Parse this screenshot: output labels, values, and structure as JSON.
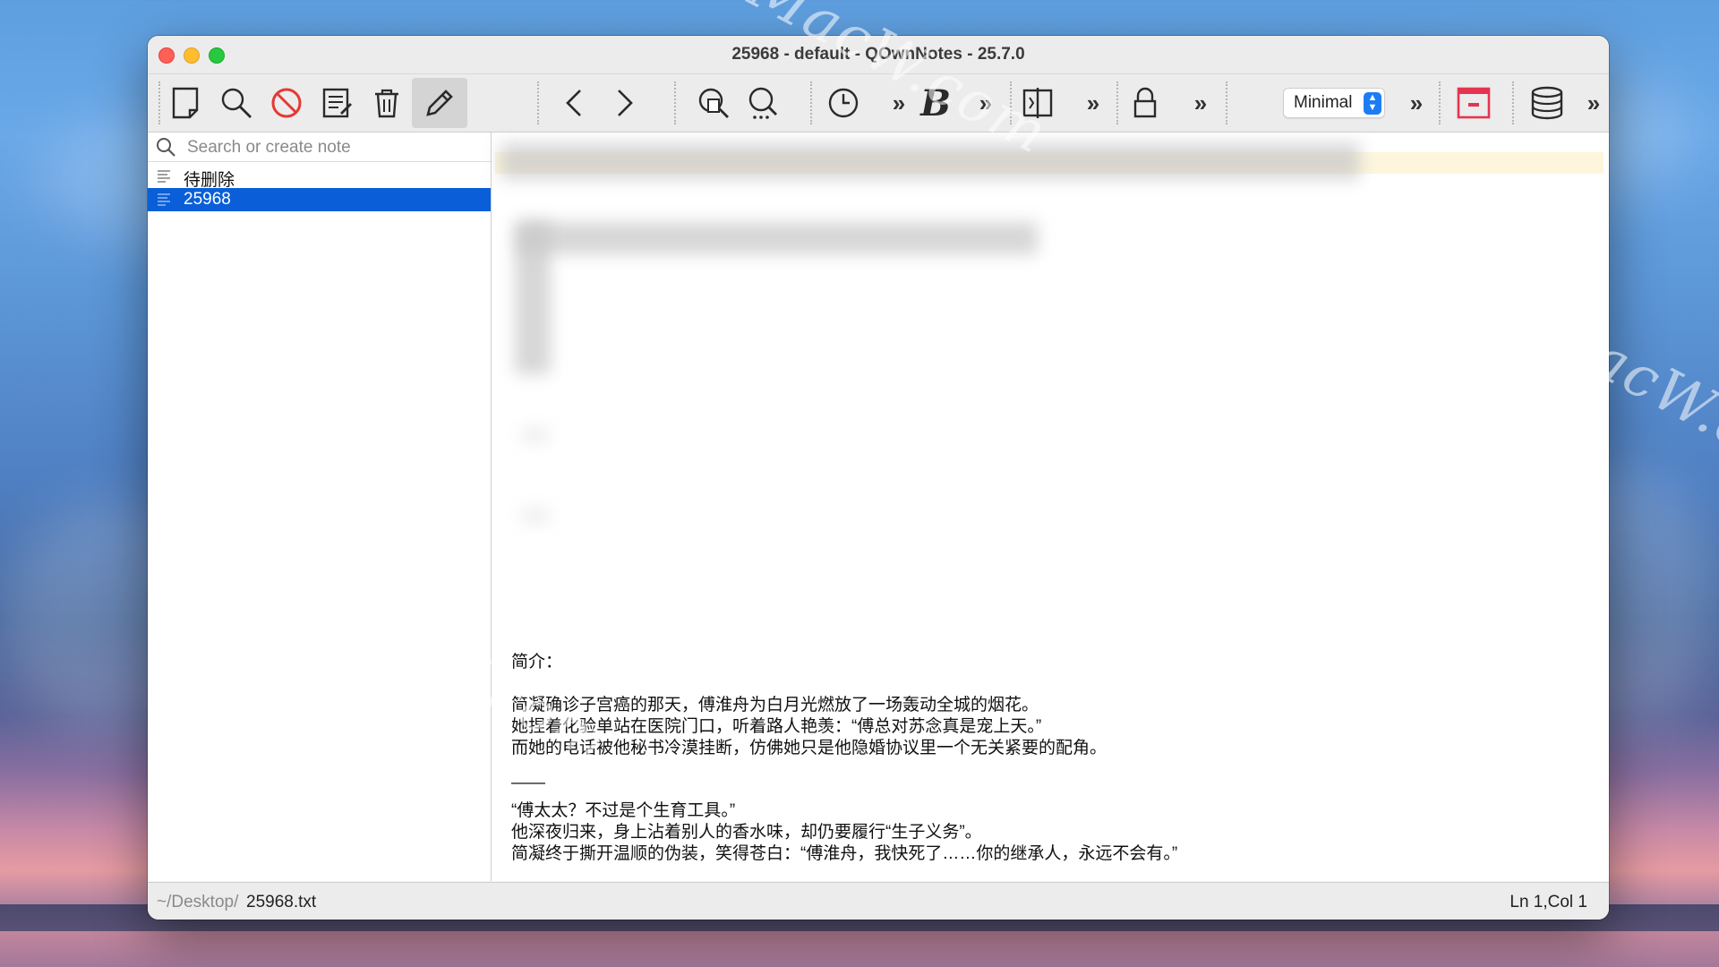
{
  "window": {
    "title": "25968 - default - QOwnNotes - 25.7.0"
  },
  "toolbar": {
    "items": [
      {
        "name": "new-note-icon"
      },
      {
        "name": "search-icon"
      },
      {
        "name": "remove-icon"
      },
      {
        "name": "notes-list-icon"
      },
      {
        "name": "trash-icon"
      },
      {
        "name": "edit-pencil-icon"
      },
      {
        "name": "back-icon"
      },
      {
        "name": "forward-icon"
      },
      {
        "name": "find-in-note-icon"
      },
      {
        "name": "search-more-icon"
      },
      {
        "name": "history-clock-icon"
      },
      {
        "name": "bold-icon"
      },
      {
        "name": "split-view-icon"
      },
      {
        "name": "lock-icon"
      },
      {
        "name": "distraction-free-icon"
      },
      {
        "name": "database-icon"
      }
    ],
    "workspace_select": "Minimal",
    "overflow_glyph": "»",
    "bold_glyph": "B"
  },
  "sidebar": {
    "search_placeholder": "Search or create note",
    "notes": [
      {
        "title": "待删除",
        "selected": false
      },
      {
        "title": "25968",
        "selected": true
      }
    ]
  },
  "editor": {
    "lines": [
      "简介：",
      "简凝确诊子宫癌的那天，傅淮舟为白月光燃放了一场轰动全城的烟花。",
      "她捏着化验单站在医院门口，听着路人艳羡：“傅总对苏念真是宠上天。”",
      "而她的电话被他秘书冷漠挂断，仿佛她只是他隐婚协议里一个无关紧要的配角。",
      "——",
      "“傅太太？不过是个生育工具。”",
      "他深夜归来，身上沾着别人的香水味，却仍要履行“生子义务”。",
      "简凝终于撕开温顺的伪装，笑得苍白：“傅淮舟，我快死了……你的继承人，永远不会有。”"
    ]
  },
  "statusbar": {
    "path_dir": "~/Desktop/",
    "path_file": "25968.txt",
    "cursor": "Ln 1,Col 1"
  },
  "watermark": {
    "text": "MacW.com"
  }
}
